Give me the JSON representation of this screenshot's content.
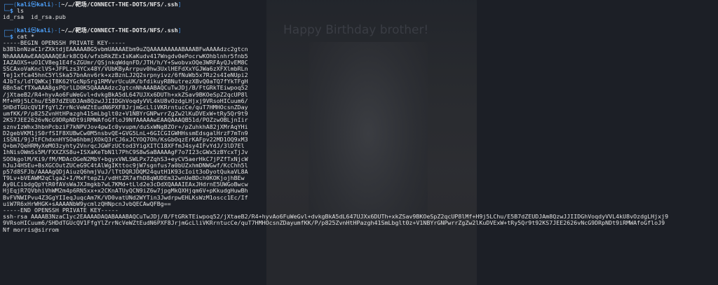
{
  "prompt": {
    "user": "kali",
    "host": "kali",
    "skull": "㉿",
    "path": "~/…/靶场/CONNECT-THE-DOTS/NFS/.ssh",
    "dollar": "$"
  },
  "background": {
    "banner": "Happy Birthday brother!"
  },
  "session": [
    {
      "command": "ls",
      "output": [
        "id_rsa  id_rsa.pub"
      ]
    },
    {
      "command": "cat *",
      "output": [
        "-----BEGIN OPENSSH PRIVATE KEY-----",
        "b3BlbnNzaC1rZXktdjEAAAAABG5vbmUAAAAEbm9uZQAAAAAAAAABAAABFwAAAAdzc2gtcn",
        "NhAAAAAwEAAQAAAQEArk8CQ4/wfxbRkZExIsKaKudv417Wngdv0ePocrwKOhblnhr5fnb5",
        "IAZAOXS+uO1CV8eg1E4fsZGUmr/QSjnkqWdqnFD/JTH/h/Y+SwobvxOQe3WRFAyQJvEM8C",
        "SSCAxoVaKnclVS+JFPLzs3YCx48Y/VUbKByArrpuv0hw3UxlHEFdXxYGJWa6zXFXlmbRLn",
        "Tej1xfCa45hnC5YlSka57bnAnv6rk+xzBznLJ2Q2srpnyivz/6fNuWb5x7Rz2s4IeNUpi2",
        "4JbTs/ldTQWKxjT8K62YGcNpSrg1RMVvrUcuUK/bfdikuyRBNutrezXBvQ0aTQ7fYkTFgH",
        "6Bn5aCfTXwAAA8gsPQrlLD0K5QAAAAdzc2gtcnNhAAABAQCuTwJDj/B/FtGRkTEiwpoq52",
        "/jXtaeB2/R4+hyvAo6FuWeGvl+dvkgBkA5dL647UJXx6DUTh+xkZSav9BKOeSpZ2qcUP8l",
        "Mf+H9j5LChu/E5B7dZEUDJAm8QzwJJIIDGhVoqdyVVL4kU8vOzdgLHjxj9VRsoHICuum6/",
        "SHDdTGUcQV1FfgYlZrrNcVeWZtEudN6PXF8JrjmGcLliVKRrntucCe/quT7HMHOcsnZDay",
        "umfKK/P/p825ZvnHtHPazgh41SmLbglt0z+V1NBYrGNPwrrZgZw2lKuDVExW+tRy5Qr9t9",
        "2KS7JEE2626vNcG9DRpNDt9iRMWAfoGfloJ9NfAAAAAwEAAQAAAQB51d/POZzwOBLjnIir",
        "sznvIzWhx3hbnPcbziF7kNPVJov4pwIc0yvupm/duSxWNgBZOr+/pZuhkhA82jXMrAqYHi",
        "D2gebVKM1jS0rfSIF8XUBwCw0M5nsbvQE+GVG5LnL+6GICGIGWHHssmEdsgalHrzF7mTn9",
        "iSSN1/9jJtFChdxnHYSOa6hbmjXOkQ3rCJ6xJCYOQ7Oh/KsGbOqzErKAFpv22MD1OQ9xM3",
        "Q+bm7QeHRMyXeMO3zyhty2VnrqcJGWFzUCtod3YigXITC18XFfmJ4sy4IFvYdJ/3lD7El",
        "1hNisOWmSs5M/FXXZXS8u+ISXaKeTbN1l7PhC9S8wSaBAAAAgF7o7I23cGWx5zBYcxTjJv",
        "SOOkgolM/Ki9/fM/MDAcOGeN2MbY+bgyxVWLSWLPx7ZqhS3+eyCV5aerHkC7jPZfTxNjcW",
        "hJuJ4HSEu+BsXGCOutZUCeG9C4tAlWgIKttoc9jW7sgnfus7a0bUZxhmDNWGwf/KcChh5l",
        "p57d8SFJb/AAAAgQDjAiuzQ6hmjVuJ/lTtDQRJDQM24qutH1K93cIoit3oDyotQukaVL8A",
        "T9Lv+bVEAWM2qClga2+I/MxFtepZi/vdHtZR7afhD8qWUDEm32wnUeBDch0KOKjojhBEw",
        "Ay0LCibdgQpYtR0fAVsWaJXJmgkb7wL7KMd+tLld2e3cDdXQAAAIEAxJHdrnE5UWGoBwcw",
        "HjEqjR7QVbhiVhWM2m4p6RN5xx+x2CKnATUyQCN9iZ6w7jpgMkQXHjqm6V+pKkudgHuwBh",
        "BvFVNWIPvu4Z3GgYIIeqJuqcAm7K/VD0vatUNd2WYTin3JwdrpwEHLKsWzM1oscc1Ec/If",
        "uiW7R6xHrWHGK+sAAAANbW9ycmlzQHNpcnJvbQECAwQFBg==",
        "-----END OPENSSH PRIVATE KEY-----",
        "ssh-rsa AAAAB3NzaC1yc2EAAAADAQABAAABAQCuTwJDj/B/FtGRkTEiwpoq52/jXtaeB2/R4+hyvAo6FuWeGvl+dvkgBkA5dL647UJXx6DUTh+xkZSav9BKOeSpZ2qcUP8lMf+H9j5LChu/E5B7dZEUDJAm8QzwJJIIDGhVoqdyVVL4kU8vOzdgLHjxj9",
        "9VRsoHICuum6/SHDdTGUcQV1FfgYlZrrNcVeWZtEudN6PXF8JrjmGcLliVKRrntucCe/quT7HMHOcsnZDayumfKK/P/p825ZvnHtHPazgh41SmLbglt0z+V1NBYrGNPwrrZgZw2lKuDVExW+tRy5Qr9t92KS7JEE2626vNcG9DRpNDt9iRMWAfoGfloJ9",
        "Nf morris@sirrom"
      ]
    }
  ]
}
